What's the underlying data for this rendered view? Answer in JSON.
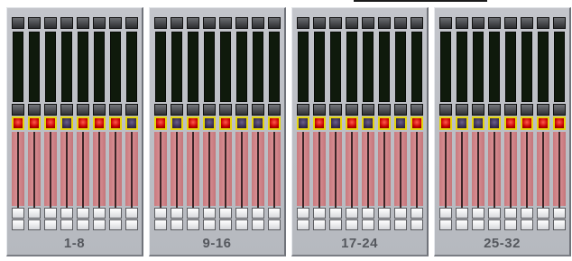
{
  "banks": [
    {
      "label": "1-8",
      "mutes": [
        true,
        true,
        true,
        false,
        true,
        true,
        true,
        false
      ]
    },
    {
      "label": "9-16",
      "mutes": [
        true,
        false,
        true,
        false,
        true,
        false,
        false,
        true
      ]
    },
    {
      "label": "17-24",
      "mutes": [
        false,
        true,
        false,
        true,
        false,
        true,
        false,
        true
      ]
    },
    {
      "label": "25-32",
      "mutes": [
        true,
        false,
        false,
        false,
        true,
        true,
        true,
        true
      ]
    }
  ],
  "colors": {
    "mute_on": "#d00000",
    "mute_off": "#3b2f55",
    "mute_border": "#e4d40c",
    "fader_track": "#d08488",
    "meter": "#0f1a0c",
    "panel": "#bfc2c8"
  }
}
